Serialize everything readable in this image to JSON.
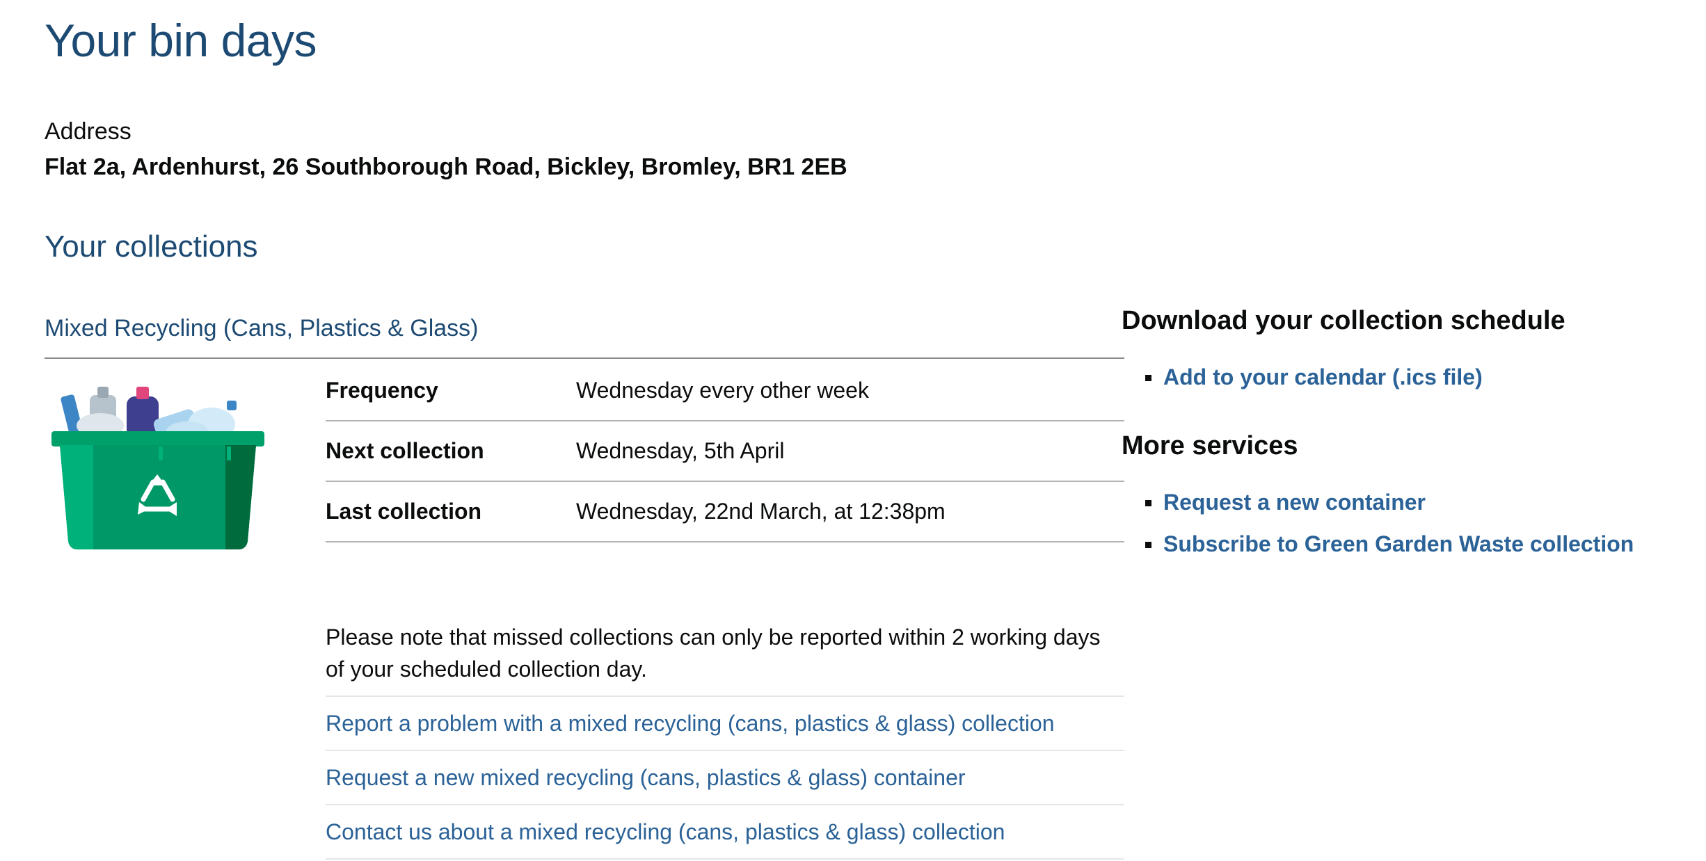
{
  "page": {
    "title": "Your bin days"
  },
  "address": {
    "label": "Address",
    "value": "Flat 2a, Ardenhurst, 26 Southborough Road, Bickley, Bromley, BR1 2EB"
  },
  "collections": {
    "heading": "Your collections",
    "service": {
      "title": "Mixed Recycling (Cans, Plastics & Glass)",
      "illustration_icon": "recycling-box-icon",
      "rows": [
        {
          "label": "Frequency",
          "value": "Wednesday every other week"
        },
        {
          "label": "Next collection",
          "value": "Wednesday, 5th April"
        },
        {
          "label": "Last collection",
          "value": "Wednesday, 22nd March, at 12:38pm"
        }
      ],
      "note": "Please note that missed collections can only be reported within 2 working days of your scheduled collection day.",
      "actions": [
        "Report a problem with a mixed recycling (cans, plastics & glass) collection",
        "Request a new mixed recycling (cans, plastics & glass) container",
        "Contact us about a mixed recycling (cans, plastics & glass) collection"
      ]
    }
  },
  "sidebar": {
    "download_heading": "Download your collection schedule",
    "download_links": [
      "Add to your calendar (.ics file)"
    ],
    "services_heading": "More services",
    "services_links": [
      "Request a new container",
      "Subscribe to Green Garden Waste collection"
    ]
  },
  "colors": {
    "heading_blue": "#1d4a73",
    "link_blue": "#2b6297",
    "box_green": "#009866",
    "text": "#0b0c0c"
  }
}
